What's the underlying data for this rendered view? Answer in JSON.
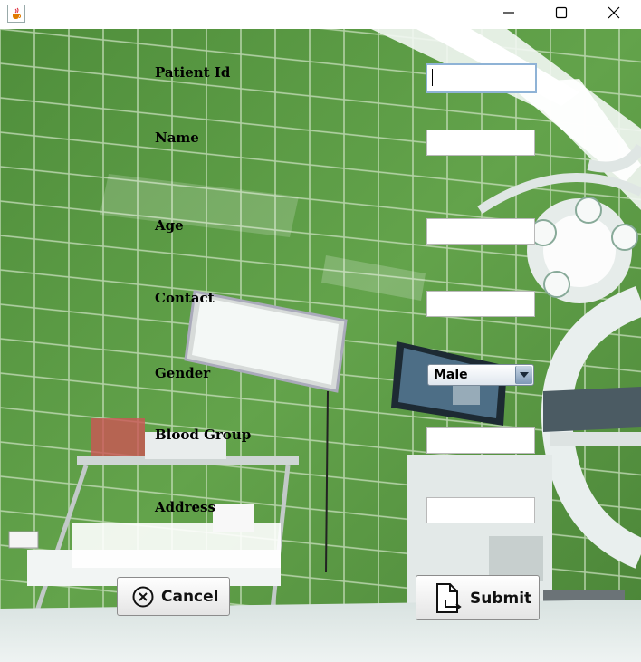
{
  "window": {
    "title_icon": "java-cup-icon",
    "controls": [
      "minimize-icon",
      "maximize-icon",
      "close-icon"
    ]
  },
  "form": {
    "patient_id": {
      "label": "Patient Id",
      "value": ""
    },
    "name": {
      "label": "Name",
      "value": ""
    },
    "age": {
      "label": "Age",
      "value": ""
    },
    "contact": {
      "label": "Contact",
      "value": ""
    },
    "gender": {
      "label": "Gender",
      "selected": "Male"
    },
    "blood_group": {
      "label": "Blood Group",
      "value": ""
    },
    "address": {
      "label": "Address",
      "value": ""
    }
  },
  "buttons": {
    "cancel": {
      "label": "Cancel",
      "icon": "cancel-circle-icon"
    },
    "submit": {
      "label": "Submit",
      "icon": "document-arrow-icon"
    }
  },
  "colors": {
    "wall_green": "#5c9c45",
    "field_focus_border": "#8fb3d6"
  }
}
